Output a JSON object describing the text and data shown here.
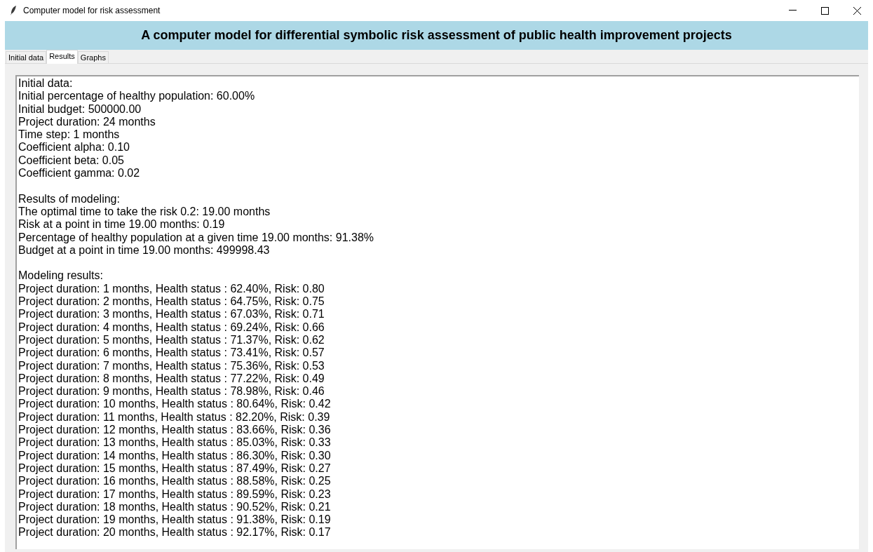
{
  "window": {
    "title": "Computer model for risk assessment"
  },
  "header": {
    "title": "A computer model for differential symbolic risk assessment of public health improvement projects"
  },
  "tabs": [
    {
      "label": "Initial data",
      "selected": false
    },
    {
      "label": "Results",
      "selected": true
    },
    {
      "label": "Graphs",
      "selected": false
    }
  ],
  "results_text": {
    "sections": [
      [
        "Initial data:",
        "Initial percentage of healthy population: 60.00%",
        "Initial budget: 500000.00",
        "Project duration: 24 months",
        "Time step: 1 months",
        "Coefficient alpha: 0.10",
        "Coefficient beta: 0.05",
        "Coefficient gamma: 0.02"
      ],
      [
        "Results of modeling:",
        "The optimal time to take the risk 0.2: 19.00 months",
        "Risk at a point in time 19.00 months: 0.19",
        "Percentage of healthy population at a given time 19.00 months: 91.38%",
        "Budget at a point in time 19.00 months: 499998.43"
      ],
      [
        "Modeling results:",
        "Project duration: 1 months, Health status : 62.40%, Risk: 0.80",
        "Project duration: 2 months, Health status : 64.75%, Risk: 0.75",
        "Project duration: 3 months, Health status : 67.03%, Risk: 0.71",
        "Project duration: 4 months, Health status : 69.24%, Risk: 0.66",
        "Project duration: 5 months, Health status : 71.37%, Risk: 0.62",
        "Project duration: 6 months, Health status : 73.41%, Risk: 0.57",
        "Project duration: 7 months, Health status : 75.36%, Risk: 0.53",
        "Project duration: 8 months, Health status : 77.22%, Risk: 0.49",
        "Project duration: 9 months, Health status : 78.98%, Risk: 0.46",
        "Project duration: 10 months, Health status : 80.64%, Risk: 0.42",
        "Project duration: 11 months, Health status : 82.20%, Risk: 0.39",
        "Project duration: 12 months, Health status : 83.66%, Risk: 0.36",
        "Project duration: 13 months, Health status : 85.03%, Risk: 0.33",
        "Project duration: 14 months, Health status : 86.30%, Risk: 0.30",
        "Project duration: 15 months, Health status : 87.49%, Risk: 0.27",
        "Project duration: 16 months, Health status : 88.58%, Risk: 0.25",
        "Project duration: 17 months, Health status : 89.59%, Risk: 0.23",
        "Project duration: 18 months, Health status : 90.52%, Risk: 0.21",
        "Project duration: 19 months, Health status : 91.38%, Risk: 0.19",
        "Project duration: 20 months, Health status : 92.17%, Risk: 0.17"
      ]
    ]
  }
}
